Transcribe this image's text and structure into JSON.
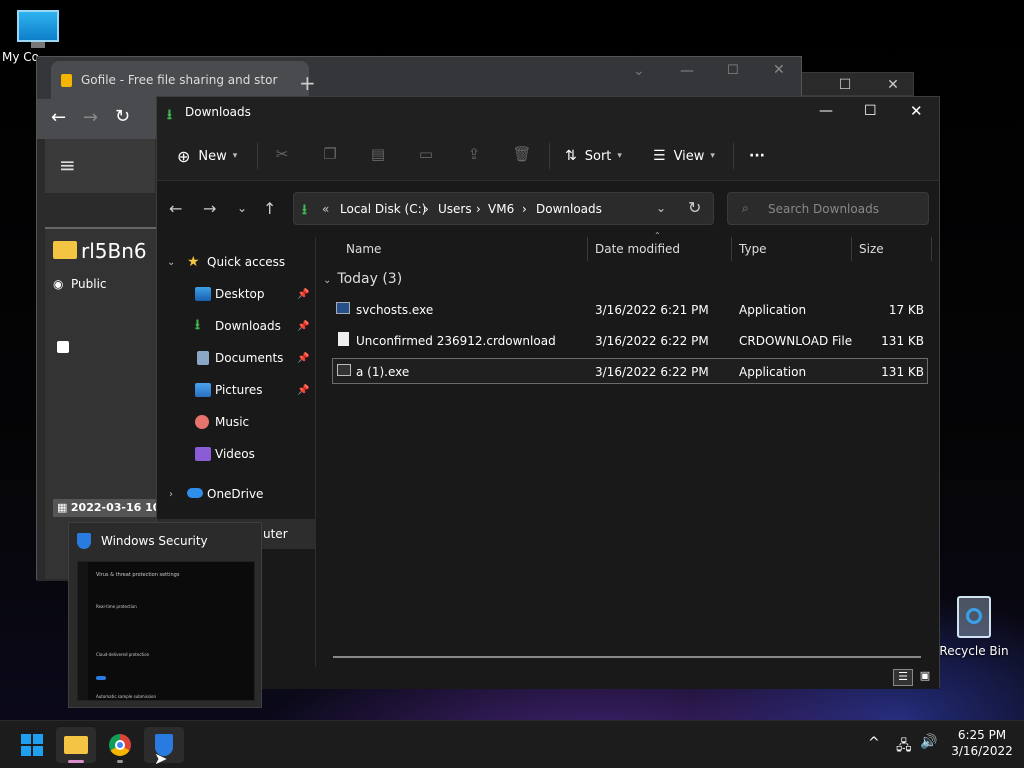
{
  "desktop": {
    "my_computer_label": "My Co",
    "recycle_bin_label": "Recycle Bin"
  },
  "chrome": {
    "tab_title": "Gofile - Free file sharing and stor",
    "folder_name": "rl5Bn6",
    "public_label": "Public",
    "date_label": "2022-03-16 10:1",
    "partial_sidebar_text": "uter"
  },
  "explorer": {
    "title": "Downloads",
    "commands": {
      "new_label": "New",
      "sort_label": "Sort",
      "view_label": "View",
      "more_label": "···"
    },
    "address": {
      "overflow": "«",
      "segments": [
        "Local Disk (C:)",
        "Users",
        "VM6",
        "Downloads"
      ]
    },
    "search_placeholder": "Search Downloads",
    "sidebar": {
      "quick_access": "Quick access",
      "items": [
        "Desktop",
        "Downloads",
        "Documents",
        "Pictures",
        "Music",
        "Videos"
      ],
      "onedrive": "OneDrive"
    },
    "columns": {
      "name": "Name",
      "date": "Date modified",
      "type": "Type",
      "size": "Size"
    },
    "group_label": "Today (3)",
    "files": [
      {
        "name": "svchosts.exe",
        "date": "3/16/2022 6:21 PM",
        "type": "Application",
        "size": "17 KB"
      },
      {
        "name": "Unconfirmed 236912.crdownload",
        "date": "3/16/2022 6:22 PM",
        "type": "CRDOWNLOAD File",
        "size": "131 KB"
      },
      {
        "name": "a (1).exe",
        "date": "3/16/2022 6:22 PM",
        "type": "Application",
        "size": "131 KB"
      }
    ]
  },
  "thumbnail": {
    "title": "Windows Security",
    "preview_heading": "Virus & threat protection settings",
    "preview_section_1": "Real-time protection",
    "preview_section_2": "Cloud-delivered protection",
    "preview_section_3": "Automatic sample submission"
  },
  "taskbar": {
    "time": "6:25 PM",
    "date": "3/16/2022"
  },
  "colors": {
    "accent_blue": "#0078d4",
    "folder_yellow": "#f4c542",
    "download_green": "#3fb950"
  }
}
